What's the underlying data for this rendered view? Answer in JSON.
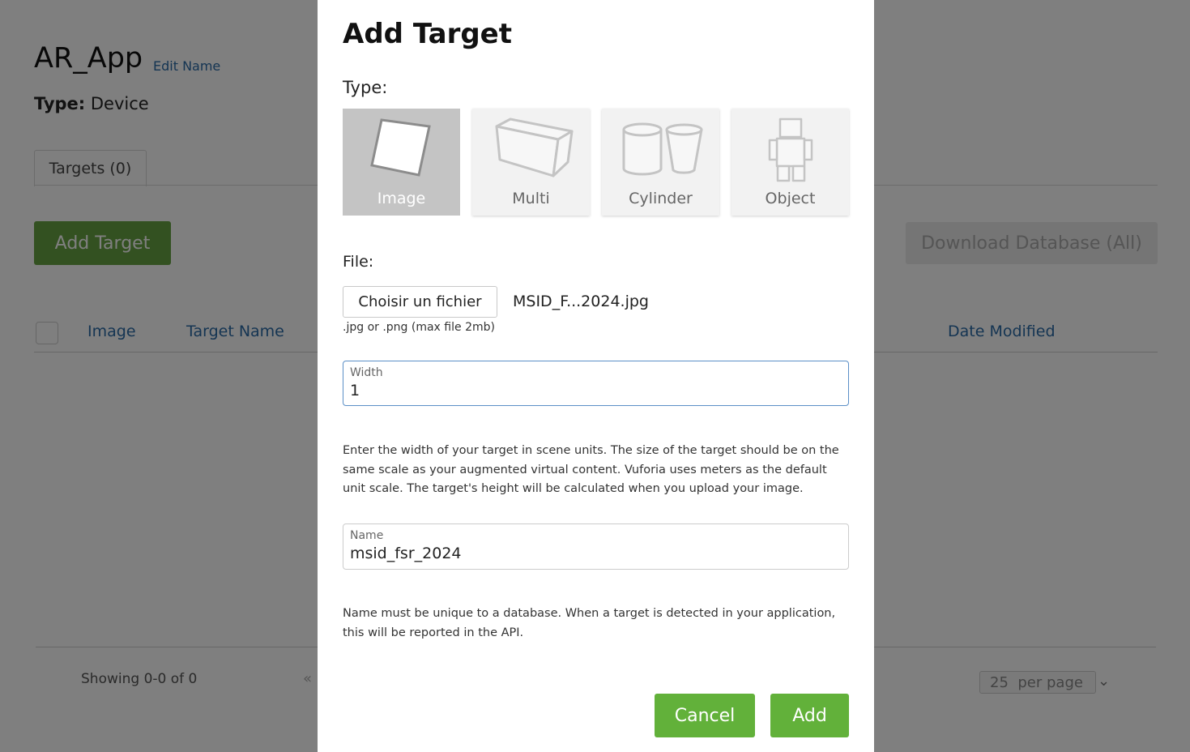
{
  "page": {
    "title": "AR_App",
    "edit_name": "Edit Name",
    "type_label": "Type:",
    "type_value": "Device",
    "tab_targets": "Targets (0)",
    "add_target": "Add Target",
    "download_database": "Download Database (All)",
    "columns": {
      "image": "Image",
      "target_name": "Target Name",
      "date_modified": "Date Modified"
    },
    "showing": "Showing 0-0 of 0",
    "prev_icon": "«",
    "per_page_value": "25",
    "per_page_label": "per page",
    "per_page_chevron": "⌄"
  },
  "modal": {
    "title": "Add Target",
    "type_label": "Type:",
    "types": [
      {
        "label": "Image",
        "icon": "image-target-icon",
        "selected": true
      },
      {
        "label": "Multi",
        "icon": "multi-target-icon",
        "selected": false
      },
      {
        "label": "Cylinder",
        "icon": "cylinder-target-icon",
        "selected": false
      },
      {
        "label": "Object",
        "icon": "object-target-icon",
        "selected": false
      }
    ],
    "file_label": "File:",
    "choose_file": "Choisir un fichier",
    "file_name": "MSID_F...2024.jpg",
    "file_hint": ".jpg or .png (max file 2mb)",
    "width_label": "Width",
    "width_value": "1",
    "width_help": "Enter the width of your target in scene units. The size of the target should be on the same scale as your augmented virtual content. Vuforia uses meters as the default unit scale. The target's height will be calculated when you upload your image.",
    "name_label": "Name",
    "name_value": "msid_fsr_2024",
    "name_help": "Name must be unique to a database. When a target is detected in your application, this will be reported in the API.",
    "cancel": "Cancel",
    "add": "Add"
  },
  "colors": {
    "primary_green": "#62b13a",
    "link_blue": "#2a6aa6",
    "overlay": "rgba(0,0,0,0.5)"
  }
}
